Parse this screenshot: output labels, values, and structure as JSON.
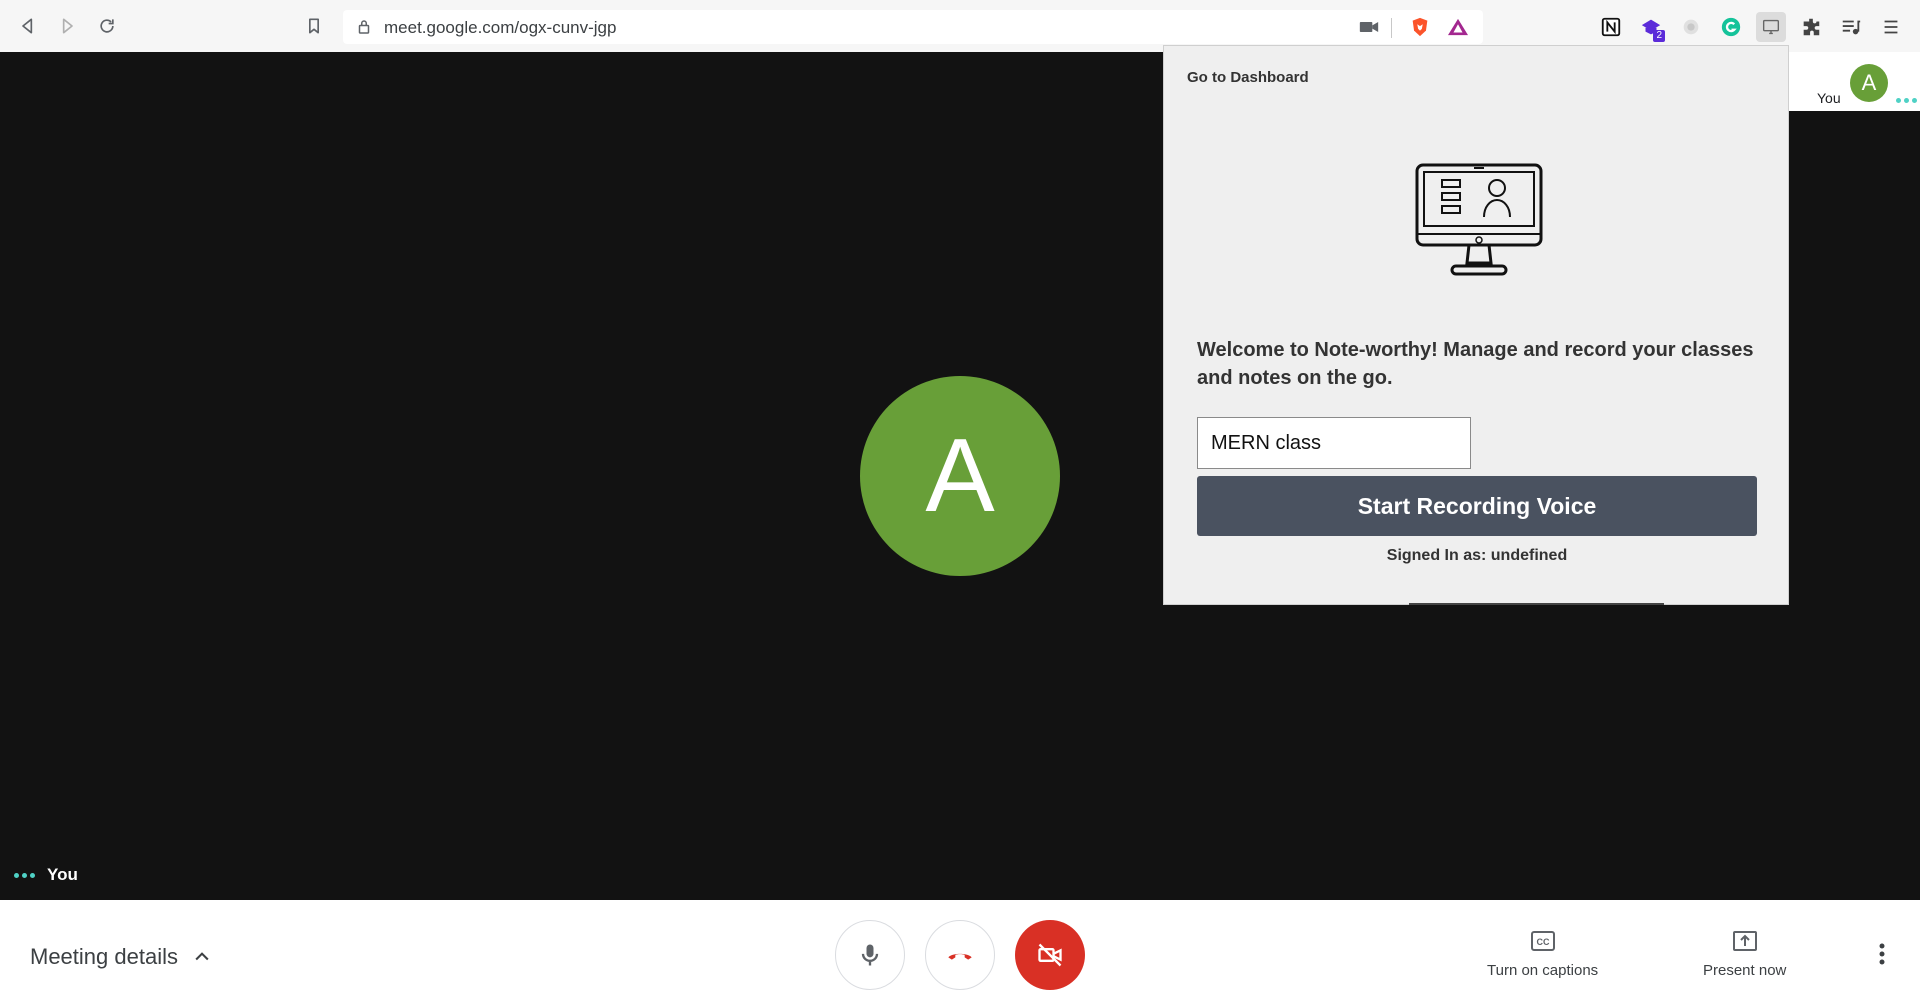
{
  "browser": {
    "url": "meet.google.com/ogx-cunv-jgp",
    "extension_badge": "2"
  },
  "meeting": {
    "main_avatar_letter": "A",
    "self_label": "You",
    "self_tile_label": "You",
    "self_tile_avatar_letter": "A",
    "avatar_color": "#689f38"
  },
  "popup": {
    "dashboard_link": "Go to Dashboard",
    "welcome_text": "Welcome to Note-worthy! Manage and record your classes and notes on the go.",
    "class_input_value": "MERN class",
    "record_button": "Start Recording Voice",
    "signed_in": "Signed In as: undefined"
  },
  "bottom": {
    "meeting_details": "Meeting details",
    "captions": "Turn on captions",
    "present": "Present now"
  },
  "colors": {
    "hangup_red": "#d93025",
    "record_button_bg": "#4a5260",
    "stage_bg": "#121212"
  }
}
